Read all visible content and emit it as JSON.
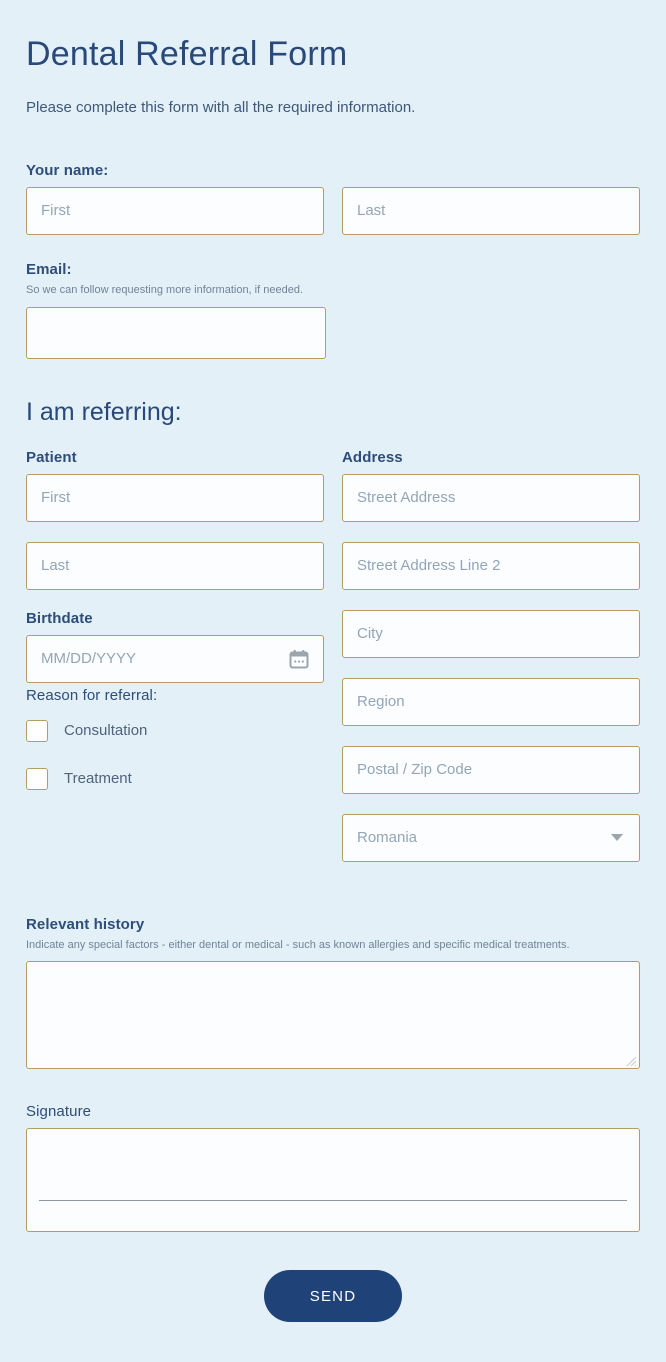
{
  "header": {
    "title": "Dental Referral Form",
    "subtitle": "Please complete this form with all the required information."
  },
  "your_name": {
    "label": "Your name:",
    "first_placeholder": "First",
    "last_placeholder": "Last",
    "first_value": "",
    "last_value": ""
  },
  "email": {
    "label": "Email:",
    "helper": "So we can follow requesting more information, if needed.",
    "placeholder": "",
    "value": ""
  },
  "referring": {
    "heading": "I am referring:",
    "patient": {
      "label": "Patient",
      "first_placeholder": "First",
      "last_placeholder": "Last",
      "first_value": "",
      "last_value": ""
    },
    "birthdate": {
      "label": "Birthdate",
      "placeholder": "MM/DD/YYYY",
      "value": "",
      "icon": "calendar-icon"
    },
    "reason": {
      "label": "Reason for referral:",
      "options": [
        {
          "label": "Consultation",
          "checked": false
        },
        {
          "label": "Treatment",
          "checked": false
        }
      ]
    },
    "address": {
      "label": "Address",
      "street_placeholder": "Street Address",
      "street2_placeholder": "Street Address Line 2",
      "city_placeholder": "City",
      "region_placeholder": "Region",
      "postal_placeholder": "Postal / Zip Code",
      "street_value": "",
      "street2_value": "",
      "city_value": "",
      "region_value": "",
      "postal_value": "",
      "country_selected": "Romania",
      "country_caret_icon": "chevron-down-icon"
    }
  },
  "relevant_history": {
    "label": "Relevant history",
    "helper": "Indicate any special factors - either dental or medical - such as known allergies and specific medical treatments.",
    "value": ""
  },
  "signature": {
    "label": "Signature",
    "value": ""
  },
  "submit": {
    "label": "SEND"
  },
  "colors": {
    "page_background": "#e4f0f7",
    "heading_navy": "#28497a",
    "label_navy": "#2d4d7a",
    "field_border_gold": "#b69b63",
    "field_fill": "#fbfdfe",
    "placeholder_gray": "#93a6b6",
    "button_navy": "#1f4379",
    "button_text": "#ffffff"
  }
}
